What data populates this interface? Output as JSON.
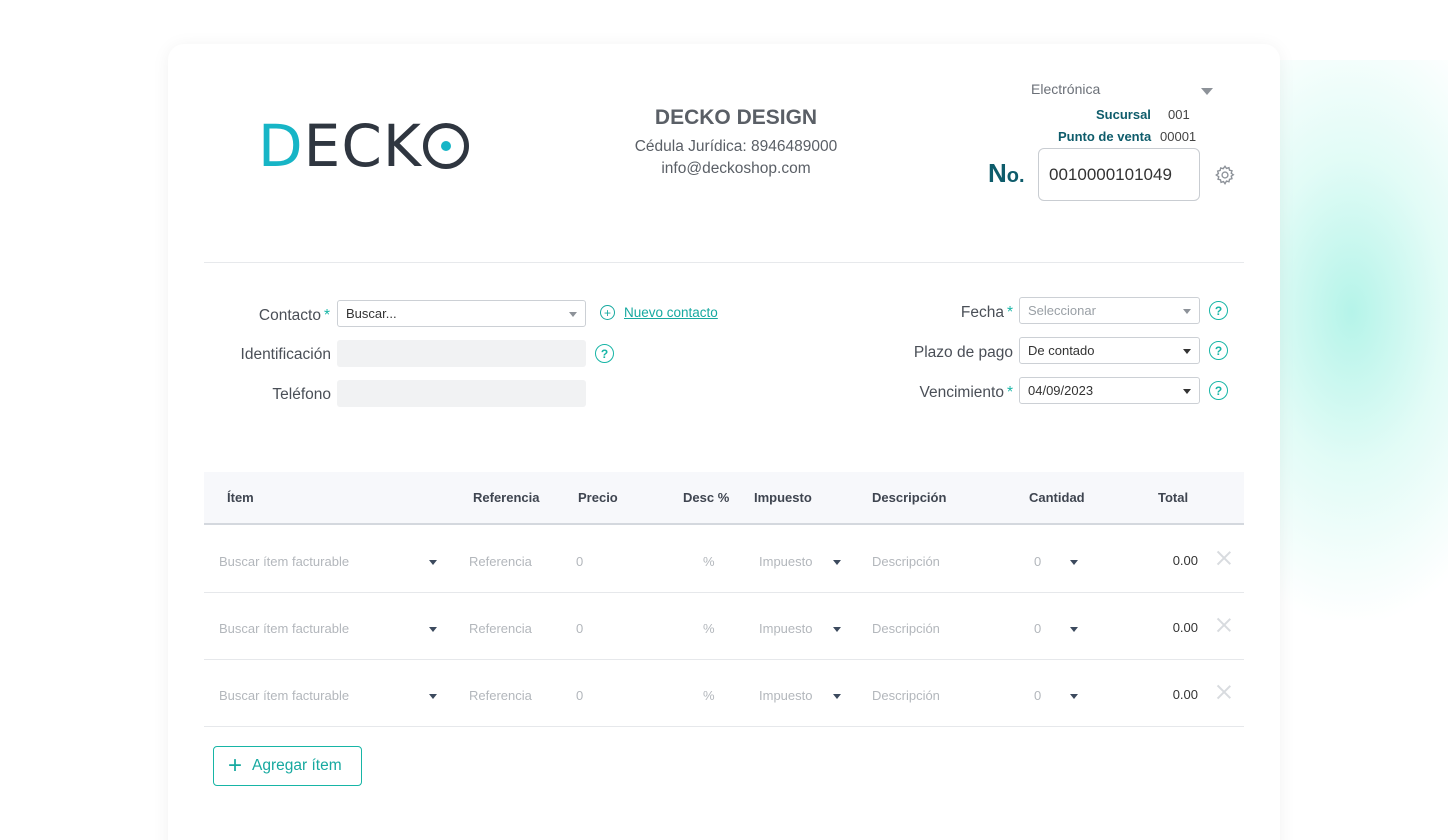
{
  "logo": {
    "first_letter": "D",
    "rest": "ECK"
  },
  "company": {
    "name": "DECKO DESIGN",
    "legal_id": "Cédula Jurídica: 8946489000",
    "email": "info@deckoshop.com"
  },
  "document": {
    "type": "Electrónica",
    "sucursal_label": "Sucursal",
    "sucursal_value": "001",
    "punto_label": "Punto de venta",
    "punto_value": "00001",
    "number_label": "N",
    "number_label_suffix": "o.",
    "number": "0010000101049"
  },
  "form": {
    "contacto": {
      "label": "Contacto",
      "required": "*",
      "placeholder": "Buscar..."
    },
    "new_contact": {
      "icon": "plus-circle-icon",
      "label": "Nuevo contacto"
    },
    "identificacion": {
      "label": "Identificación",
      "value": ""
    },
    "telefono": {
      "label": "Teléfono",
      "value": ""
    },
    "fecha": {
      "label": "Fecha",
      "required": "*",
      "placeholder": "Seleccionar"
    },
    "plazo": {
      "label": "Plazo de pago",
      "value": "De contado"
    },
    "vencimiento": {
      "label": "Vencimiento",
      "required": "*",
      "value": "04/09/2023"
    },
    "help_symbol": "?"
  },
  "table": {
    "headers": [
      "Ítem",
      "Referencia",
      "Precio",
      "Desc %",
      "Impuesto",
      "Descripción",
      "Cantidad",
      "Total"
    ],
    "rows": [
      {
        "item": "Buscar ítem facturable",
        "referencia": "Referencia",
        "precio": "0",
        "desc": "%",
        "impuesto": "Impuesto",
        "descripcion": "Descripción",
        "cantidad": "0",
        "total": "0.00"
      },
      {
        "item": "Buscar ítem facturable",
        "referencia": "Referencia",
        "precio": "0",
        "desc": "%",
        "impuesto": "Impuesto",
        "descripcion": "Descripción",
        "cantidad": "0",
        "total": "0.00"
      },
      {
        "item": "Buscar ítem facturable",
        "referencia": "Referencia",
        "precio": "0",
        "desc": "%",
        "impuesto": "Impuesto",
        "descripcion": "Descripción",
        "cantidad": "0",
        "total": "0.00"
      }
    ]
  },
  "add_item": {
    "icon": "plus-icon",
    "label": "Agregar ítem"
  },
  "colors": {
    "accent": "#17b5a6",
    "brand_cyan": "#17b5c6",
    "dark_teal": "#0e5c6b",
    "text_dark": "#2f3640"
  }
}
